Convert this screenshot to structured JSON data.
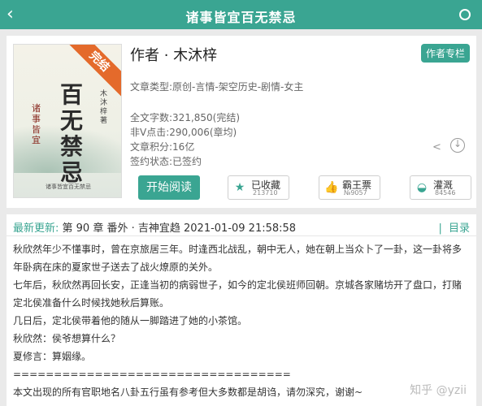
{
  "header": {
    "title": "诸事皆宜百无禁忌",
    "back_icon": "chevron-left-icon"
  },
  "book": {
    "cover": {
      "ribbon": "完结",
      "title": "百无禁忌",
      "subtitle": "诸事皆宜",
      "author": "木沐梓 著",
      "footer": "诸事皆宜百无禁忌"
    },
    "author": "作者 · 木沐梓",
    "column_button": "作者专栏",
    "type": "文章类型:原创-言情-架空历史-剧情-女主",
    "words": "全文字数:321,850(完结)",
    "clicks": "非V点击:290,006(章均)",
    "score": "文章积分:16亿",
    "status": "签约状态:已签约",
    "read_button": "开始阅读",
    "actions": [
      {
        "label": "已收藏",
        "value": "213710",
        "icon": "star-icon"
      },
      {
        "label": "霸王票",
        "value": "№9057",
        "icon": "thumbs-up-icon"
      },
      {
        "label": "灌溉",
        "value": "84546",
        "icon": "watering-can-icon"
      }
    ]
  },
  "chapter": {
    "latest_label": "最新更新:",
    "latest_text": "第 90 章 番外 · 吉神宜趋 2021-01-09 21:58:58",
    "directory": "目录",
    "paragraphs": [
      "秋欣然年少不懂事时，曾在京旅居三年。时逢西北战乱，朝中无人，她在朝上当众卜了一卦，这一卦将多年卧病在床的夏家世子送去了战火燎原的关外。",
      "七年后，秋欣然再回长安，正逢当初的病弱世子，如今的定北侯班师回朝。京城各家赌坊开了盘口，打赌定北侯准备什么时候找她秋后算账。",
      "几日后，定北侯带着他的随从一脚踏进了她的小茶馆。",
      "秋欣然：侯爷想算什么？",
      "夏修言：算姻缘。",
      "==================================",
      "本文出现的所有官职地名八卦五行虽有参考但大多数都是胡诌，请勿深究，谢谢~"
    ]
  },
  "watermark": "知乎 @yzii"
}
